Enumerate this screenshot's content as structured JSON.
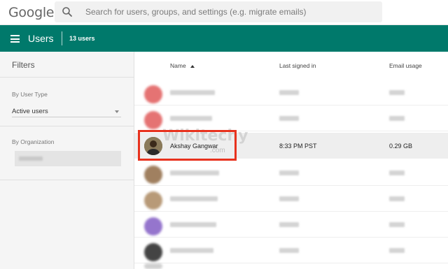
{
  "app": {
    "logo": "Google"
  },
  "search": {
    "placeholder": "Search for users, groups, and settings (e.g. migrate emails)"
  },
  "header": {
    "title": "Users",
    "count": "13 users"
  },
  "sidebar": {
    "title": "Filters",
    "user_type_label": "By User Type",
    "user_type_value": "Active users",
    "org_label": "By Organization"
  },
  "table": {
    "columns": {
      "name": "Name",
      "last_signed_in": "Last signed in",
      "email_usage": "Email usage"
    },
    "selected_row": {
      "name": "Akshay Gangwar",
      "last_signed_in": "8:33 PM PST",
      "email_usage": "0.29 GB"
    }
  },
  "watermark": {
    "text": "Wikitechy",
    "sub": ".com"
  },
  "colors": {
    "header_bg": "#00796b",
    "highlight_border": "#e8321e"
  }
}
